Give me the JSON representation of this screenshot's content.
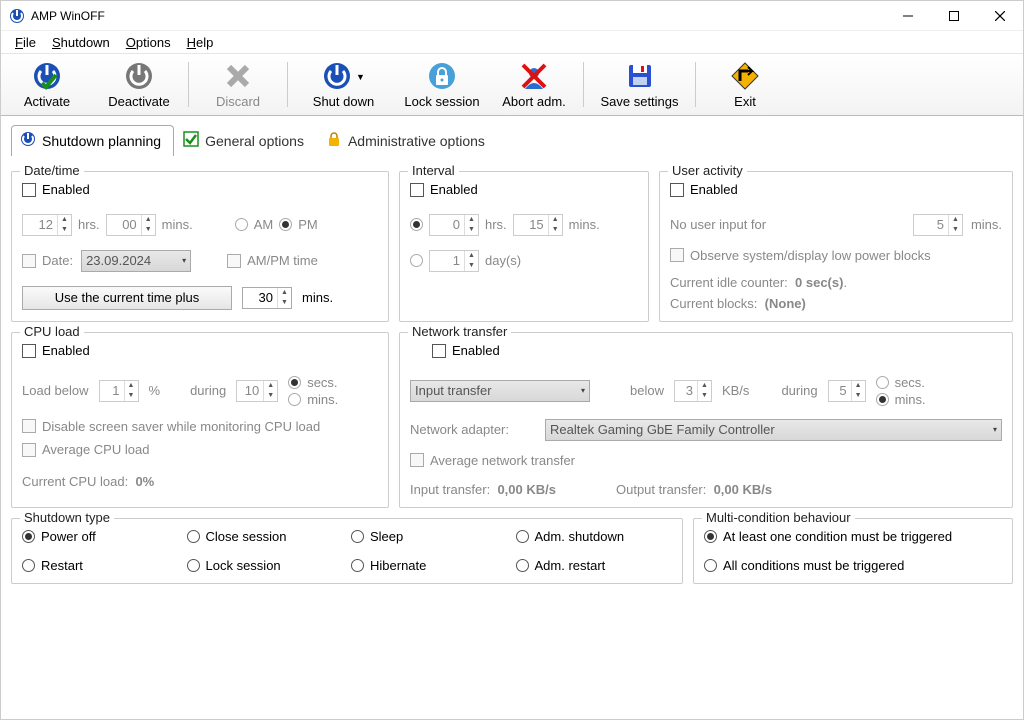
{
  "app": {
    "title": "AMP WinOFF"
  },
  "menu": {
    "file": "File",
    "shutdown": "Shutdown",
    "options": "Options",
    "help": "Help"
  },
  "toolbar": {
    "activate": "Activate",
    "deactivate": "Deactivate",
    "discard": "Discard",
    "shutdown": "Shut down",
    "lock": "Lock session",
    "abort": "Abort adm.",
    "save": "Save settings",
    "exit": "Exit"
  },
  "tabs": {
    "shutdown": "Shutdown planning",
    "general": "General options",
    "admin": "Administrative options"
  },
  "datetime": {
    "legend": "Date/time",
    "enabled": "Enabled",
    "hours": "12",
    "hrs_lbl": "hrs.",
    "mins": "00",
    "mins_lbl": "mins.",
    "am": "AM",
    "pm": "PM",
    "date_lbl": "Date:",
    "date_val": "23.09.2024",
    "ampm_time": "AM/PM time",
    "use_current": "Use the current time plus",
    "plus_val": "30",
    "plus_mins": "mins."
  },
  "interval": {
    "legend": "Interval",
    "enabled": "Enabled",
    "hours": "0",
    "hrs_lbl": "hrs.",
    "mins": "15",
    "mins_lbl": "mins.",
    "days": "1",
    "days_lbl": "day(s)"
  },
  "useractivity": {
    "legend": "User activity",
    "enabled": "Enabled",
    "noinput": "No user input for",
    "noinput_val": "5",
    "mins_lbl": "mins.",
    "observe": "Observe system/display low power blocks",
    "idle_lbl": "Current idle counter:",
    "idle_val": "0 sec(s)",
    "blocks_lbl": "Current blocks:",
    "blocks_val": "(None)"
  },
  "cpu": {
    "legend": "CPU load",
    "enabled": "Enabled",
    "below_lbl": "Load below",
    "below_val": "1",
    "pct": "%",
    "during_lbl": "during",
    "during_val": "10",
    "secs": "secs.",
    "mins": "mins.",
    "disable_ss": "Disable screen saver while monitoring CPU load",
    "avg": "Average CPU load",
    "cur_lbl": "Current CPU load:",
    "cur_val": "0%"
  },
  "net": {
    "legend": "Network transfer",
    "enabled": "Enabled",
    "transfer_type": "Input transfer",
    "below_lbl": "below",
    "below_val": "3",
    "kbs": "KB/s",
    "during_lbl": "during",
    "during_val": "5",
    "secs": "secs.",
    "mins": "mins.",
    "adapter_lbl": "Network adapter:",
    "adapter_val": "Realtek Gaming GbE Family Controller",
    "avg": "Average network transfer",
    "in_lbl": "Input transfer:",
    "in_val": "0,00 KB/s",
    "out_lbl": "Output transfer:",
    "out_val": "0,00 KB/s"
  },
  "shutdowntype": {
    "legend": "Shutdown type",
    "poweroff": "Power off",
    "close": "Close session",
    "sleep": "Sleep",
    "adm_shutdown": "Adm. shutdown",
    "restart": "Restart",
    "lock": "Lock session",
    "hibernate": "Hibernate",
    "adm_restart": "Adm. restart"
  },
  "multi": {
    "legend": "Multi-condition behaviour",
    "one": "At least one condition must be triggered",
    "all": "All conditions must be triggered"
  }
}
